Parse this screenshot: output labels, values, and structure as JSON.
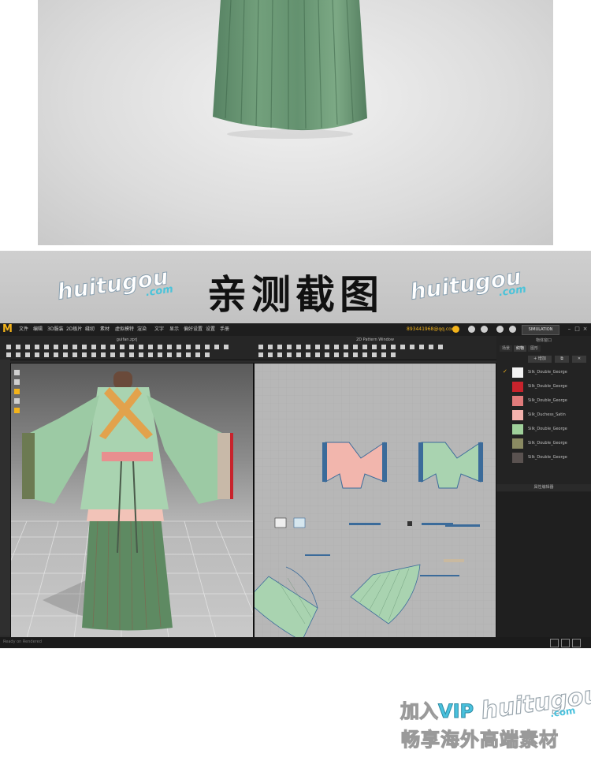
{
  "banner": {
    "title": "亲测截图",
    "watermark": "huitugou",
    "watermark_com": ".com"
  },
  "app": {
    "menu": [
      "文件",
      "编辑",
      "3D服装",
      "2D板片",
      "缝纫",
      "素材",
      "虚拟模特",
      "渲染",
      "文字",
      "显示",
      "偏好设置",
      "设置",
      "手册"
    ],
    "account": "893441968@qq.com",
    "simulation_label": "SIMULATION",
    "tab_3d_title": "guifan.zprj",
    "tab_2d_title": "2D Pattern Window",
    "right_panel": {
      "header": "物体窗口",
      "tabs": [
        "场景",
        "织物",
        "图形"
      ],
      "add_button": "+ 增加",
      "fabrics": [
        {
          "name": "Silk_Double_George",
          "color": "#f2f2f2",
          "selected": true
        },
        {
          "name": "Silk_Double_George",
          "color": "#c8232c",
          "selected": false
        },
        {
          "name": "Silk_Double_George",
          "color": "#e07b7b",
          "selected": false
        },
        {
          "name": "Silk_Duchess_Satin",
          "color": "#f3b2ad",
          "selected": false
        },
        {
          "name": "Silk_Double_George",
          "color": "#9fd09a",
          "selected": false
        },
        {
          "name": "Silk_Double_George",
          "color": "#8a8a62",
          "selected": false
        },
        {
          "name": "Silk_Double_George",
          "color": "#5a5250",
          "selected": false
        }
      ],
      "property_header": "属性编辑器"
    },
    "status_text": "Ready on Rendered"
  },
  "footer": {
    "line1_prefix": "加入",
    "line1_vip": "VIP",
    "logo": "huitugou",
    "logo_com": ".com",
    "line2": "畅享海外高端素材"
  }
}
